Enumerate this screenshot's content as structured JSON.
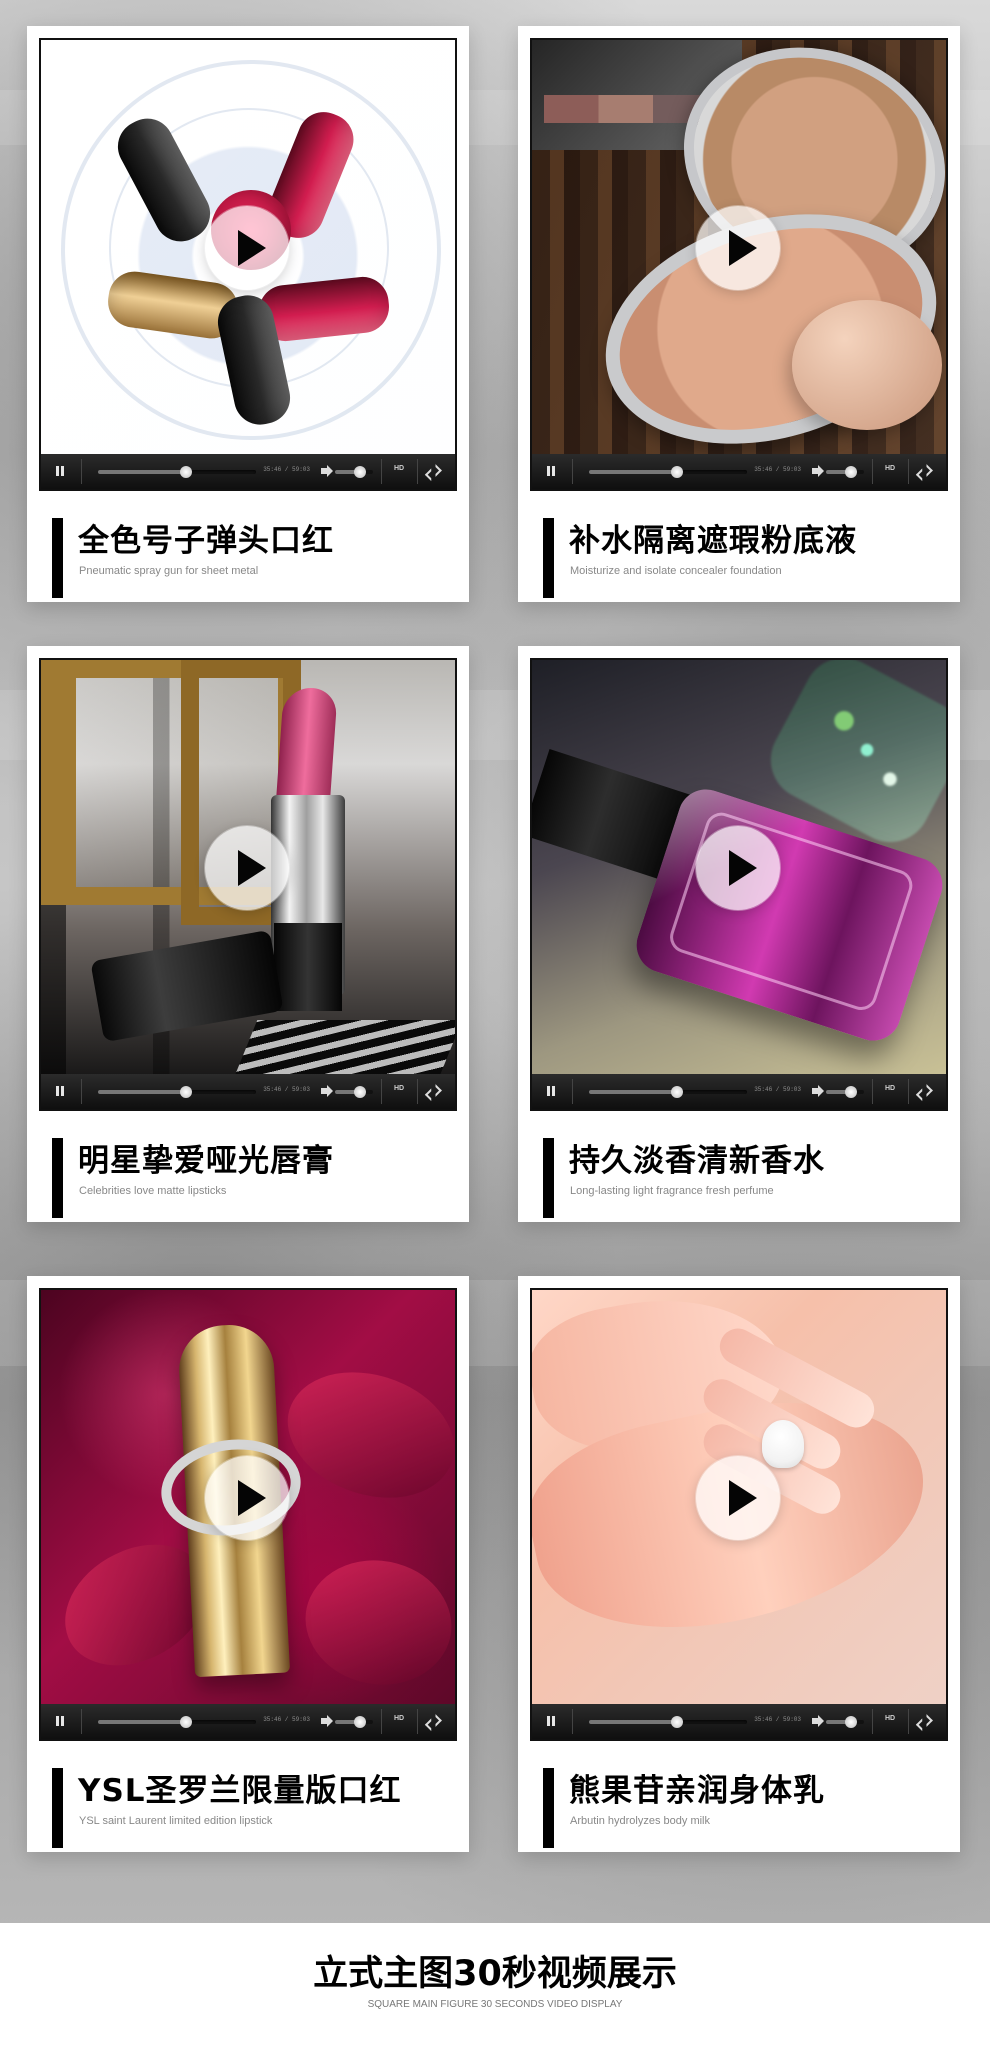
{
  "videos": [
    {
      "title": "全色号子弹头口红",
      "subtitle": "Pneumatic spray gun for sheet metal",
      "time": "35:46 / 59:03",
      "hd": "HD",
      "progress": 0.56,
      "volume": 0.65
    },
    {
      "title": "补水隔离遮瑕粉底液",
      "subtitle": "Moisturize and isolate concealer foundation",
      "time": "35:46 / 59:03",
      "hd": "HD",
      "progress": 0.56,
      "volume": 0.65
    },
    {
      "title": "明星挚爱哑光唇膏",
      "subtitle": "Celebrities love matte lipsticks",
      "time": "35:46 / 59:03",
      "hd": "HD",
      "progress": 0.56,
      "volume": 0.65
    },
    {
      "title": "持久淡香清新香水",
      "subtitle": "Long-lasting light fragrance fresh perfume",
      "time": "35:46 / 59:03",
      "hd": "HD",
      "progress": 0.56,
      "volume": 0.65
    },
    {
      "title": "YSL圣罗兰限量版口红",
      "subtitle": "YSL saint Laurent limited edition lipstick",
      "time": "35:46 / 59:03",
      "hd": "HD",
      "progress": 0.56,
      "volume": 0.65
    },
    {
      "title": "熊果苷亲润身体乳",
      "subtitle": "Arbutin hydrolyzes body milk",
      "time": "35:46 / 59:03",
      "hd": "HD",
      "progress": 0.56,
      "volume": 0.65
    }
  ],
  "footer": {
    "title": "立式主图30秒视频展示",
    "subtitle": "SQUARE MAIN FIGURE 30 SECONDS VIDEO DISPLAY"
  },
  "colors": {
    "card_background": "#ffffff",
    "caption_bar": "#000000",
    "player_controls": "#111111",
    "footer_background": "#ffffff"
  },
  "icons": {
    "play": "play-icon",
    "pause": "pause-icon",
    "volume": "volume-icon",
    "fullscreen": "fullscreen-icon"
  }
}
